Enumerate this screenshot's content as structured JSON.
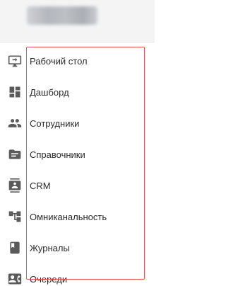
{
  "sidebar": {
    "items": [
      {
        "icon": "desktop-icon",
        "label": "Рабочий стол"
      },
      {
        "icon": "dashboard-icon",
        "label": "Дашборд"
      },
      {
        "icon": "people-icon",
        "label": "Сотрудники"
      },
      {
        "icon": "folder-icon",
        "label": "Справочники"
      },
      {
        "icon": "contact-card-icon",
        "label": "CRM"
      },
      {
        "icon": "omnichannel-icon",
        "label": "Омниканальность"
      },
      {
        "icon": "book-icon",
        "label": "Журналы"
      },
      {
        "icon": "queue-icon",
        "label": "Очереди"
      }
    ]
  },
  "colors": {
    "highlight_border": "#e8525b",
    "icon": "#5a5a5a",
    "text": "#2a2a2a",
    "header_bg": "#f4f4f4"
  }
}
